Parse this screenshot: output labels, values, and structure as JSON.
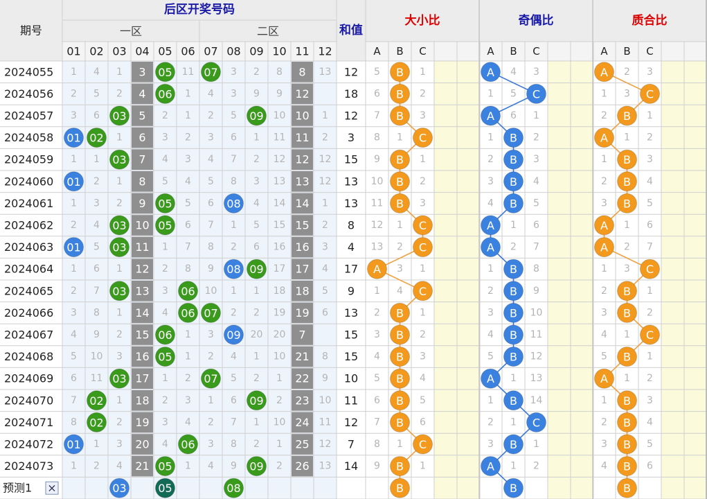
{
  "header": {
    "period_label": "期号",
    "back_zone_title": "后区开奖号码",
    "zone1_label": "一区",
    "zone2_label": "二区",
    "sum_label": "和值",
    "size_ratio_label": "大小比",
    "parity_ratio_label": "奇偶比",
    "prime_ratio_label": "质合比",
    "numbers": [
      "01",
      "02",
      "03",
      "04",
      "05",
      "06",
      "07",
      "08",
      "09",
      "10",
      "11",
      "12"
    ],
    "abc": [
      "A",
      "B",
      "C"
    ]
  },
  "colors": {
    "title_blue": "#1a1aa8",
    "title_red": "#dd0000",
    "ball_green": "#3a9a1c",
    "ball_blue": "#3b82e0",
    "ball_darkgreen": "#136a55",
    "ball_red": "#c42a2a",
    "ball_orange": "#f39a1e",
    "gray_cell": "#8f8f8f",
    "omit_text": "#b4b4b4"
  },
  "chart_data": {
    "type": "table",
    "periods": [
      "2024055",
      "2024056",
      "2024057",
      "2024058",
      "2024059",
      "2024060",
      "2024061",
      "2024062",
      "2024063",
      "2024064",
      "2024065",
      "2024066",
      "2024067",
      "2024068",
      "2024069",
      "2024070",
      "2024071",
      "2024072",
      "2024073"
    ],
    "numbers": [
      [
        "1",
        "4",
        "1",
        "3",
        "05",
        "11",
        "07",
        "3",
        "2",
        "8",
        "8",
        "13"
      ],
      [
        "2",
        "5",
        "2",
        "4",
        "06",
        "1",
        "4",
        "3",
        "9",
        "9",
        "12"
      ],
      [
        "3",
        "6",
        "03",
        "5",
        "2",
        "1",
        "2",
        "5",
        "09",
        "10",
        "10",
        "1"
      ],
      [
        "01",
        "02",
        "1",
        "6",
        "3",
        "2",
        "3",
        "6",
        "1",
        "11",
        "11",
        "2"
      ],
      [
        "1",
        "1",
        "03",
        "7",
        "4",
        "3",
        "4",
        "7",
        "2",
        "12",
        "12",
        "12"
      ],
      [
        "01",
        "2",
        "1",
        "8",
        "5",
        "4",
        "5",
        "8",
        "3",
        "13",
        "13",
        "12"
      ],
      [
        "1",
        "3",
        "2",
        "9",
        "05",
        "5",
        "6",
        "08",
        "4",
        "14",
        "14",
        "1"
      ],
      [
        "2",
        "4",
        "03",
        "10",
        "05",
        "6",
        "7",
        "1",
        "5",
        "15",
        "15",
        "2"
      ],
      [
        "01",
        "5",
        "03",
        "11",
        "1",
        "7",
        "8",
        "2",
        "6",
        "16",
        "16",
        "3"
      ],
      [
        "1",
        "6",
        "1",
        "12",
        "2",
        "8",
        "9",
        "08",
        "09",
        "17",
        "17",
        "4"
      ],
      [
        "2",
        "7",
        "03",
        "13",
        "3",
        "06",
        "10",
        "1",
        "1",
        "18",
        "18",
        "5"
      ],
      [
        "3",
        "8",
        "1",
        "14",
        "4",
        "06",
        "07",
        "2",
        "2",
        "19",
        "19",
        "6"
      ],
      [
        "4",
        "9",
        "2",
        "15",
        "06",
        "1",
        "3",
        "09",
        "20",
        "20",
        "7"
      ],
      [
        "5",
        "10",
        "3",
        "16",
        "05",
        "1",
        "2",
        "4",
        "1",
        "10",
        "21",
        "8"
      ],
      [
        "6",
        "11",
        "03",
        "17",
        "1",
        "2",
        "07",
        "5",
        "2",
        "1",
        "22",
        "9"
      ],
      [
        "7",
        "02",
        "1",
        "18",
        "2",
        "3",
        "1",
        "6",
        "09",
        "2",
        "23",
        "10"
      ],
      [
        "8",
        "02",
        "2",
        "19",
        "3",
        "4",
        "2",
        "7",
        "1",
        "10",
        "24",
        "11"
      ],
      [
        "01",
        "1",
        "3",
        "20",
        "4",
        "06",
        "3",
        "8",
        "2",
        "1",
        "25",
        "12"
      ],
      [
        "1",
        "2",
        "4",
        "21",
        "05",
        "1",
        "4",
        "9",
        "09",
        "2",
        "26",
        "13"
      ]
    ],
    "sum": [
      "12",
      "18",
      "12",
      "3",
      "15",
      "13",
      "13",
      "8",
      "4",
      "17",
      "9",
      "13",
      "15",
      "15",
      "10",
      "11",
      "12",
      "7",
      "14"
    ],
    "size_ratio": [
      [
        "5",
        "B",
        "1"
      ],
      [
        "6",
        "B",
        "2"
      ],
      [
        "7",
        "B",
        "3"
      ],
      [
        "8",
        "1",
        "C"
      ],
      [
        "9",
        "B",
        "1"
      ],
      [
        "10",
        "B",
        "2"
      ],
      [
        "11",
        "B",
        "3"
      ],
      [
        "12",
        "1",
        "C"
      ],
      [
        "13",
        "2",
        "C"
      ],
      [
        "A",
        "3",
        "1"
      ],
      [
        "1",
        "4",
        "C"
      ],
      [
        "2",
        "B",
        "1"
      ],
      [
        "3",
        "B",
        "2"
      ],
      [
        "4",
        "B",
        "3"
      ],
      [
        "5",
        "B",
        "4"
      ],
      [
        "6",
        "B",
        "5"
      ],
      [
        "7",
        "B",
        "6"
      ],
      [
        "8",
        "1",
        "C"
      ],
      [
        "9",
        "B",
        "1"
      ]
    ],
    "parity_ratio": [
      [
        "A",
        "4",
        "3"
      ],
      [
        "1",
        "5",
        "C"
      ],
      [
        "A",
        "6",
        "1"
      ],
      [
        "1",
        "B",
        "2"
      ],
      [
        "2",
        "B",
        "3"
      ],
      [
        "3",
        "B",
        "4"
      ],
      [
        "4",
        "B",
        "5"
      ],
      [
        "A",
        "1",
        "6"
      ],
      [
        "A",
        "2",
        "7"
      ],
      [
        "1",
        "B",
        "8"
      ],
      [
        "2",
        "B",
        "9"
      ],
      [
        "3",
        "B",
        "10"
      ],
      [
        "4",
        "B",
        "11"
      ],
      [
        "5",
        "B",
        "12"
      ],
      [
        "A",
        "1",
        "13"
      ],
      [
        "1",
        "B",
        "14"
      ],
      [
        "2",
        "1",
        "C"
      ],
      [
        "3",
        "B",
        "1"
      ],
      [
        "A",
        "1",
        "2"
      ]
    ],
    "prime_ratio": [
      [
        "A",
        "2",
        "3"
      ],
      [
        "1",
        "3",
        "C"
      ],
      [
        "2",
        "B",
        "1"
      ],
      [
        "A",
        "1",
        "2"
      ],
      [
        "1",
        "B",
        "3"
      ],
      [
        "2",
        "B",
        "4"
      ],
      [
        "3",
        "B",
        "5"
      ],
      [
        "A",
        "1",
        "6"
      ],
      [
        "A",
        "2",
        "7"
      ],
      [
        "1",
        "3",
        "C"
      ],
      [
        "2",
        "B",
        "1"
      ],
      [
        "3",
        "B",
        "2"
      ],
      [
        "4",
        "1",
        "C"
      ],
      [
        "5",
        "B",
        "1"
      ],
      [
        "A",
        "1",
        "2"
      ],
      [
        "1",
        "B",
        "3"
      ],
      [
        "2",
        "B",
        "4"
      ],
      [
        "3",
        "B",
        "5"
      ],
      [
        "4",
        "B",
        "6"
      ]
    ],
    "prediction": {
      "label": "预测1",
      "close_symbol": "×",
      "numbers": [
        "03",
        "05",
        "08"
      ],
      "size": "B",
      "parity": "B",
      "prime": "B"
    }
  }
}
